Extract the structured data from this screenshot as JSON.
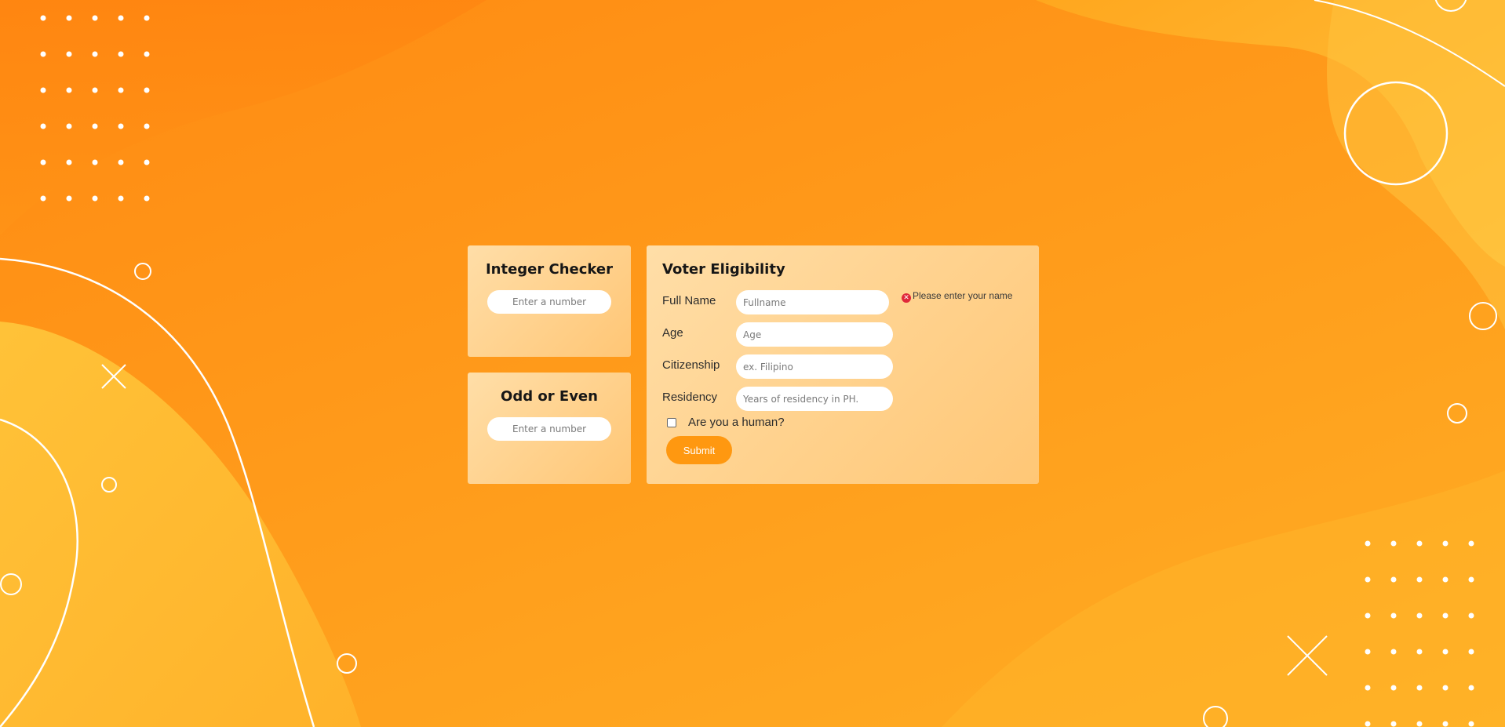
{
  "theme": {
    "accent": "#ff9810",
    "background_from": "#ff8a12",
    "background_to": "#ffae24",
    "error": "#e0283a"
  },
  "integer_checker": {
    "title": "Integer Checker",
    "input_placeholder": "Enter a number",
    "input_value": ""
  },
  "odd_or_even": {
    "title": "Odd or Even",
    "input_placeholder": "Enter a number",
    "input_value": ""
  },
  "voter_eligibility": {
    "title": "Voter Eligibility",
    "fields": {
      "full_name": {
        "label": "Full Name",
        "placeholder": "Fullname",
        "value": ""
      },
      "age": {
        "label": "Age",
        "placeholder": "Age",
        "value": ""
      },
      "citizenship": {
        "label": "Citizenship",
        "placeholder": "ex. Filipino",
        "value": ""
      },
      "residency": {
        "label": "Residency",
        "placeholder": "Years of residency in PH.",
        "value": ""
      }
    },
    "error": {
      "icon": "error-x-icon",
      "text": "Please enter your name"
    },
    "human_check": {
      "label": "Are you a human?",
      "checked": false
    },
    "submit_label": "Submit"
  }
}
